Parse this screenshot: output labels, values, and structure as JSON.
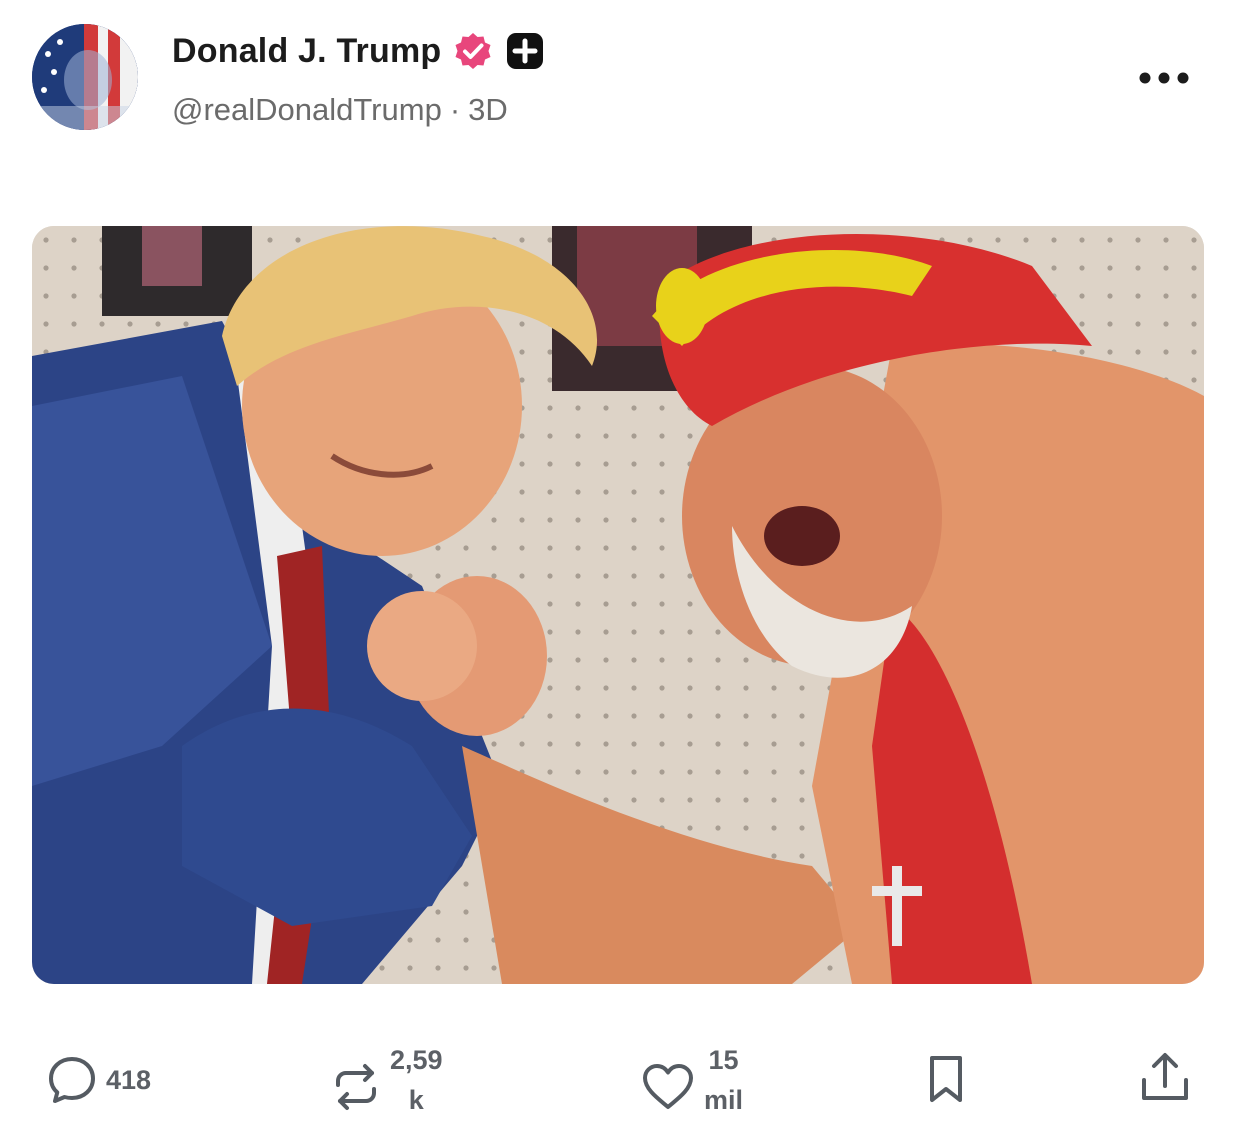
{
  "post": {
    "author": {
      "display_name": "Donald J. Trump",
      "handle": "@realDonaldTrump",
      "separator": "·",
      "age": "3D",
      "verified_icon": "verified-badge-icon",
      "follow_icon": "plus-square-icon",
      "avatar_icon": "american-flag-portrait-avatar"
    },
    "more_icon": "more-horizontal-icon",
    "actions": {
      "reply": {
        "icon": "comment-icon",
        "count": "418"
      },
      "repost": {
        "icon": "repost-icon",
        "count_line1": "2,59",
        "count_line2": "k"
      },
      "like": {
        "icon": "heart-icon",
        "count_line1": "15",
        "count_line2": "mil"
      },
      "bookmark": {
        "icon": "bookmark-icon"
      },
      "share": {
        "icon": "share-upload-icon"
      }
    }
  },
  "colors": {
    "verified_badge": "#e8467c",
    "text_primary": "#1c1c1c",
    "text_secondary": "#6b6b6b",
    "icon_gray": "#555b62"
  }
}
